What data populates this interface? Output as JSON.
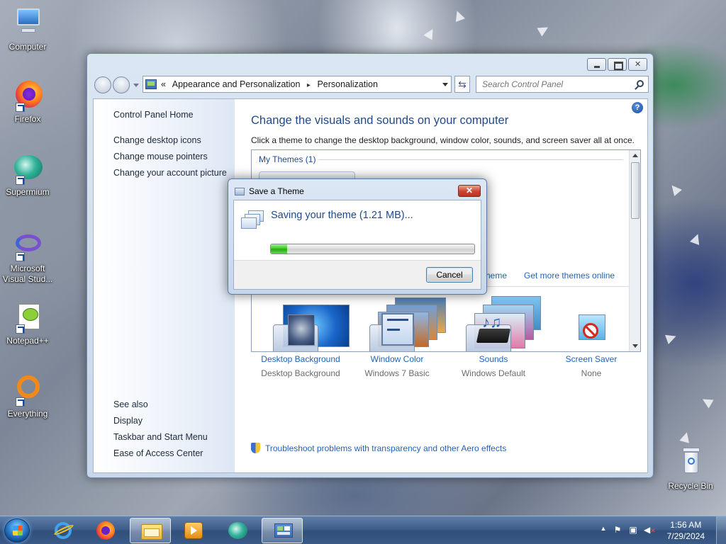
{
  "desktop": {
    "icons": [
      {
        "label": "Computer",
        "icon": "computer-icon"
      },
      {
        "label": "Firefox",
        "icon": "firefox-icon"
      },
      {
        "label": "Supermium",
        "icon": "supermium-icon"
      },
      {
        "label": "Microsoft Visual Stud...",
        "icon": "visual-studio-icon"
      },
      {
        "label": "Notepad++",
        "icon": "notepadpp-icon"
      },
      {
        "label": "Everything",
        "icon": "everything-icon"
      },
      {
        "label": "Recycle Bin",
        "icon": "recycle-bin-icon"
      }
    ]
  },
  "window": {
    "breadcrumb": {
      "prefix": "«",
      "items": [
        "Appearance and Personalization",
        "Personalization"
      ],
      "separator": "▸"
    },
    "search_placeholder": "Search Control Panel",
    "left_pane": {
      "home": "Control Panel Home",
      "links": [
        "Change desktop icons",
        "Change mouse pointers",
        "Change your account picture"
      ],
      "see_also_label": "See also",
      "see_also": [
        "Display",
        "Taskbar and Start Menu",
        "Ease of Access Center"
      ]
    },
    "title": "Change the visuals and sounds on your computer",
    "subtitle": "Click a theme to change the desktop background, window color, sounds, and screen saver all at once.",
    "themes": {
      "group_label": "My Themes (1)",
      "link_partial": "heme",
      "link_online": "Get more themes online"
    },
    "bottom": [
      {
        "label": "Desktop Background",
        "value": "Desktop Background",
        "icon": "desktop-background-icon"
      },
      {
        "label": "Window Color",
        "value": "Windows 7 Basic",
        "icon": "window-color-icon"
      },
      {
        "label": "Sounds",
        "value": "Windows Default",
        "icon": "sounds-icon"
      },
      {
        "label": "Screen Saver",
        "value": "None",
        "icon": "screen-saver-icon"
      }
    ],
    "troubleshoot": "Troubleshoot problems with transparency and other Aero effects"
  },
  "dialog": {
    "title": "Save a Theme",
    "message": "Saving your theme (1.21 MB)...",
    "progress": 0.08,
    "cancel_label": "Cancel",
    "close_glyph": "✕"
  },
  "taskbar": {
    "apps": [
      "internet-explorer-icon",
      "firefox-icon",
      "file-explorer-icon",
      "media-player-icon",
      "supermium-icon",
      "control-panel-icon"
    ],
    "time": "1:56 AM",
    "date": "7/29/2024"
  },
  "colors": {
    "link": "#1f63b8",
    "heading": "#1f4a8a",
    "progress_fill": "#33c41f"
  }
}
